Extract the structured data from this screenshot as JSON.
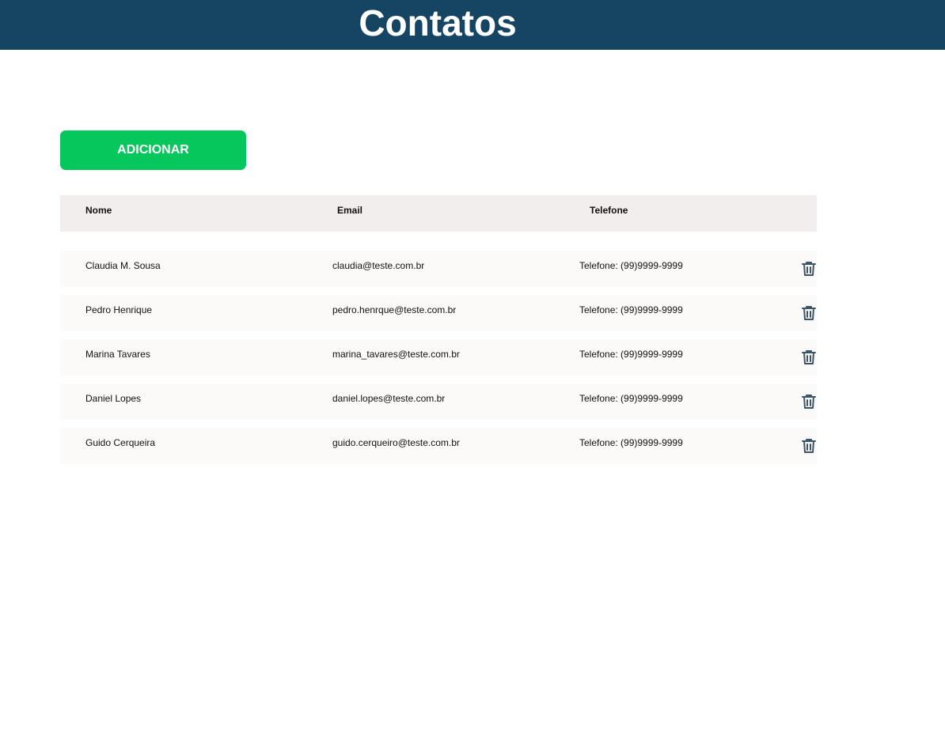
{
  "header": {
    "title": "Contatos"
  },
  "actions": {
    "add_label": "ADICIONAR"
  },
  "table": {
    "columns": {
      "name": "Nome",
      "email": "Email",
      "phone": "Telefone"
    },
    "rows": [
      {
        "name": "Claudia M. Sousa",
        "email": "claudia@teste.com.br",
        "phone": "Telefone: (99)9999-9999"
      },
      {
        "name": "Pedro Henrique",
        "email": "pedro.henrque@teste.com.br",
        "phone": "Telefone: (99)9999-9999"
      },
      {
        "name": "Marina Tavares",
        "email": "marina_tavares@teste.com.br",
        "phone": "Telefone: (99)9999-9999"
      },
      {
        "name": "Daniel Lopes",
        "email": "daniel.lopes@teste.com.br",
        "phone": "Telefone: (99)9999-9999"
      },
      {
        "name": "Guido Cerqueira",
        "email": "guido.cerqueiro@teste.com.br",
        "phone": "Telefone: (99)9999-9999"
      }
    ],
    "delete_icon": "trash-icon"
  },
  "colors": {
    "header_bg": "#154562",
    "add_button": "#06c75c",
    "table_head_bg": "#f2eeee",
    "row_bg": "#fcf9f9",
    "icon": "#3b566b"
  }
}
